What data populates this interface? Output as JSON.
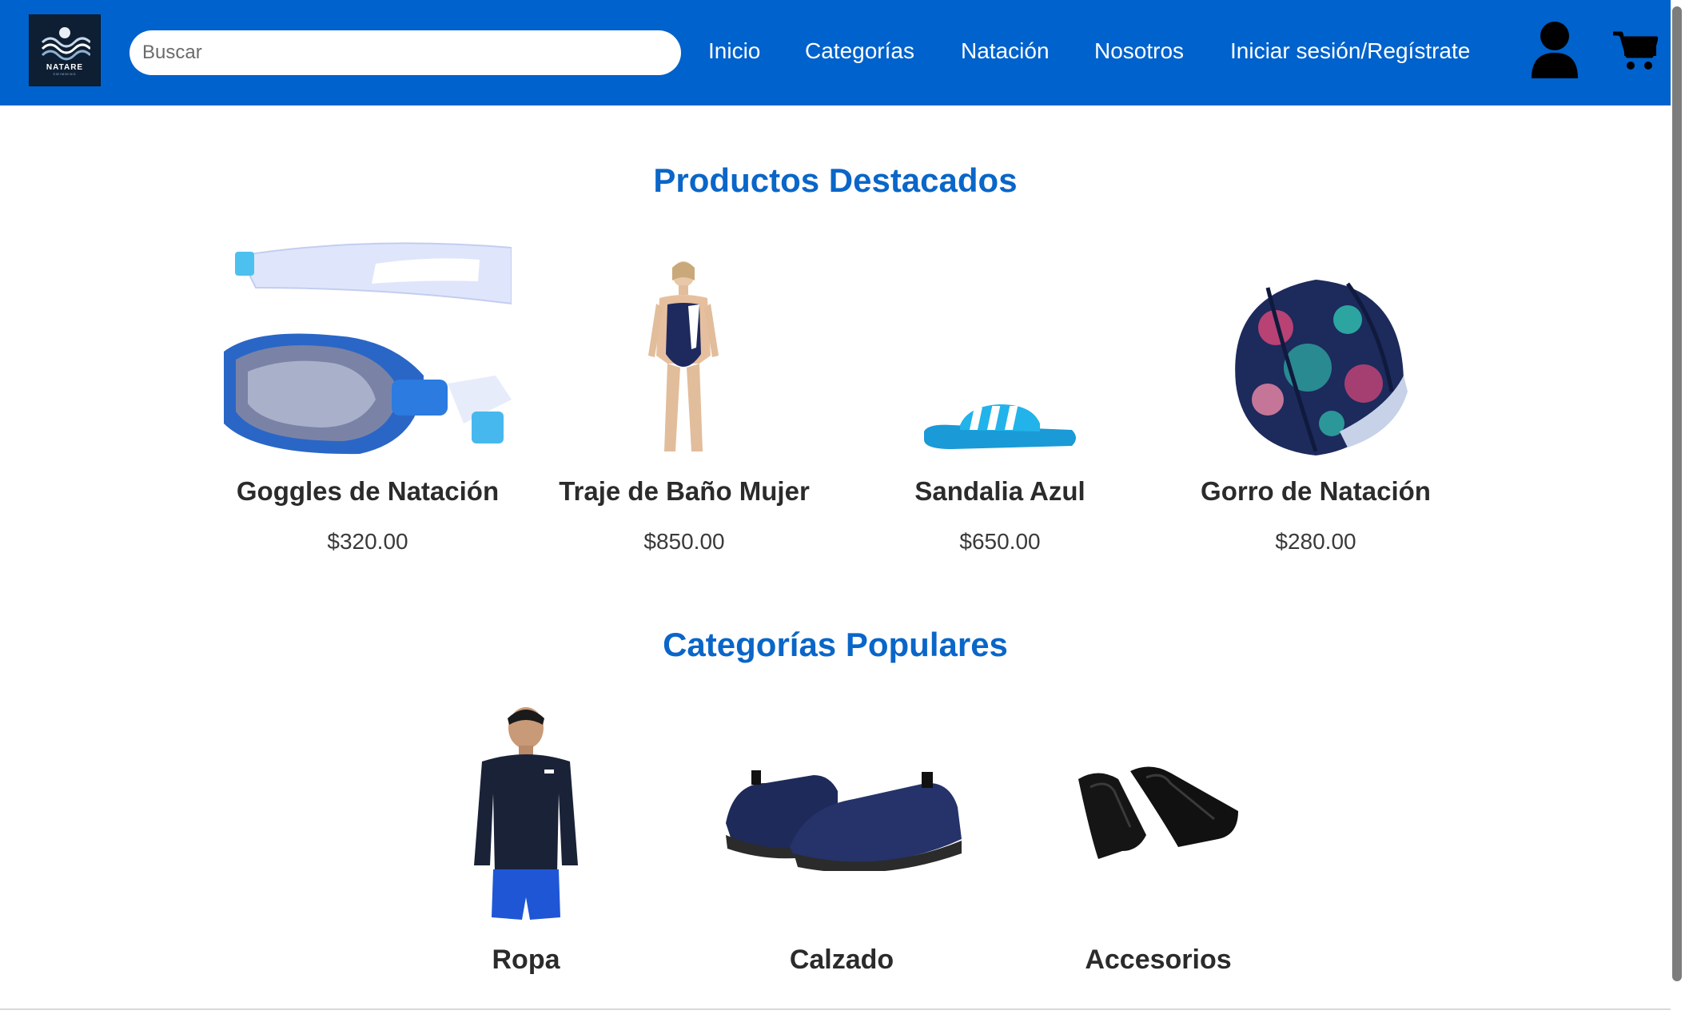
{
  "brand": {
    "logo_text": "NATARE",
    "logo_subtext": "SWIMMING"
  },
  "search": {
    "placeholder": "Buscar"
  },
  "nav": {
    "items": [
      {
        "label": "Inicio"
      },
      {
        "label": "Categorías"
      },
      {
        "label": "Natación"
      },
      {
        "label": "Nosotros"
      },
      {
        "label": "Iniciar sesión/Regístrate"
      }
    ]
  },
  "icons": {
    "user": "user-icon",
    "cart": "cart-icon"
  },
  "featured": {
    "title": "Productos Destacados",
    "products": [
      {
        "name": "Goggles de Natación",
        "price": "$320.00"
      },
      {
        "name": "Traje de Baño Mujer",
        "price": "$850.00"
      },
      {
        "name": "Sandalia Azul",
        "price": "$650.00"
      },
      {
        "name": "Gorro de Natación",
        "price": "$280.00"
      }
    ]
  },
  "popular": {
    "title": "Categorías Populares",
    "categories": [
      {
        "name": "Ropa"
      },
      {
        "name": "Calzado"
      },
      {
        "name": "Accesorios"
      }
    ]
  },
  "colors": {
    "header": "#0062cc",
    "accent_title": "#0a66c8",
    "text_dark": "#2b2b2b"
  }
}
